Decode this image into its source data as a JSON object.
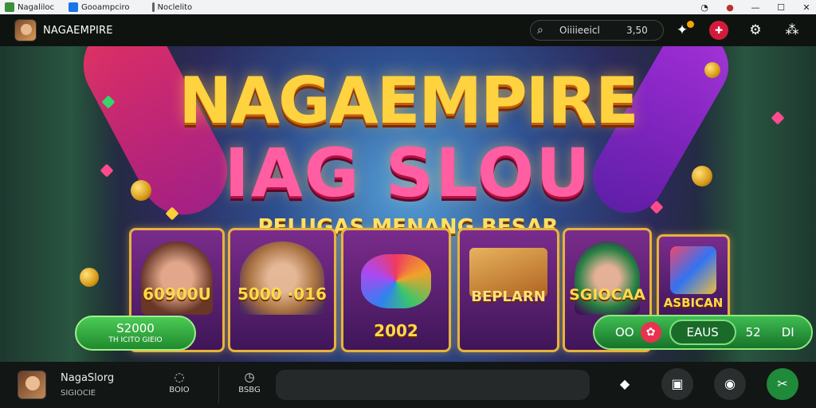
{
  "os_bar": {
    "tabs": [
      {
        "label": "Nagaliloc",
        "color": "#3a8f3a"
      },
      {
        "label": "Gooampciro",
        "color": "#1a73e8"
      },
      {
        "label": "Noclelito",
        "color": "#5f6368"
      }
    ],
    "controls": [
      "history-icon",
      "pin-icon",
      "minimize-icon",
      "maximize-icon",
      "close-icon"
    ]
  },
  "header": {
    "brand": "NAGAEMPIRE",
    "search": {
      "query": "Oiiiieeicl",
      "balance": "3,50"
    },
    "icons": [
      "notification-icon",
      "badge-icon",
      "settings-icon",
      "profile-network-icon"
    ]
  },
  "banner": {
    "title_line1": "NAGAEMPIRE",
    "title_line2": "IAG SLOU",
    "tagline": "PELUGAS MENANG BESAR",
    "cards": [
      {
        "label": "60900U"
      },
      {
        "label": "5000 ·016"
      },
      {
        "label": "2002"
      },
      {
        "label": "BEPLARN"
      },
      {
        "label": "SGIOCAA"
      },
      {
        "label": "ASBICAN"
      }
    ],
    "left_pill": {
      "amount": "S2000",
      "sub": "TH ICITO GIEIO"
    },
    "right_pill": {
      "v1": "OO",
      "v2": "EAUS",
      "v3": "52",
      "v4": "DI"
    },
    "accent_gold": "#ffd23f",
    "accent_pink": "#ff5ea2"
  },
  "footer": {
    "title": "NagaSlorg",
    "subtitle": "SIGIOCIE",
    "btn1": "BOIO",
    "btn2": "BSBG",
    "icons": [
      "tag-icon",
      "book-icon",
      "refresh-icon",
      "tools-icon"
    ]
  }
}
